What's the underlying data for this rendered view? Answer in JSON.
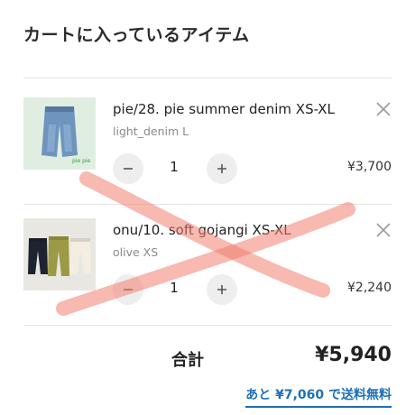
{
  "cart": {
    "title": "カートに入っているアイテム",
    "items": [
      {
        "name": "pie/28. pie summer denim XS-XL",
        "variant": "light_denim L",
        "quantity": "1",
        "price": "¥3,700",
        "thumb_label": "pie pie"
      },
      {
        "name": "onu/10. soft gojangi XS-XL",
        "variant": "olive XS",
        "quantity": "1",
        "price": "¥2,240"
      }
    ],
    "total_label": "合計",
    "total_value": "¥5,940",
    "free_shipping_link": "あと ¥7,060 で送料無料"
  },
  "icons": {
    "remove": "close-icon",
    "decrease": "minus-icon",
    "increase": "plus-icon"
  },
  "colors": {
    "link": "#1f6fb5",
    "qty_button_bg": "#eeeeee",
    "cross_mark": "#f08070"
  }
}
